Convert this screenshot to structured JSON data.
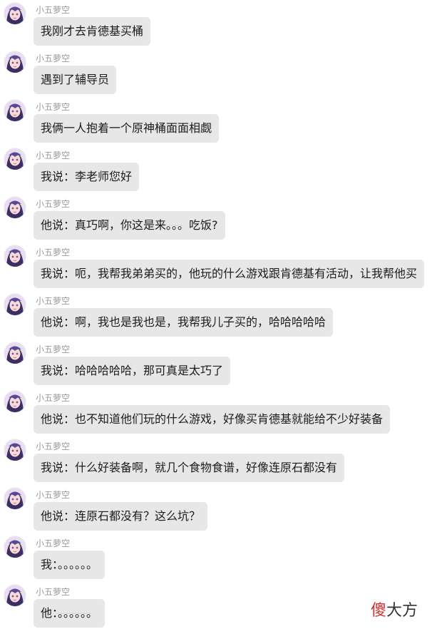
{
  "conversation": {
    "sender_name": "小五萝空",
    "messages": [
      {
        "text": "我刚才去肯德基买桶"
      },
      {
        "text": "遇到了辅导员"
      },
      {
        "text": "我俩一人抱着一个原神桶面面相觑"
      },
      {
        "text": "我说：李老师您好"
      },
      {
        "text": "他说：真巧啊，你这是来。。。吃饭?"
      },
      {
        "text": "我说：呃，我帮我弟弟买的，他玩的什么游戏跟肯德基有活动，让我帮他买"
      },
      {
        "text": "他说：啊，我也是我也是，我帮我儿子买的，哈哈哈哈哈"
      },
      {
        "text": "我说：哈哈哈哈哈，那可真是太巧了"
      },
      {
        "text": "他说：也不知道他们玩的什么游戏，好像买肯德基就能给不少好装备"
      },
      {
        "text": "我说：什么好装备啊，就几个食物食谱，好像连原石都没有"
      },
      {
        "text": "他说：连原石都没有？这么坑？"
      },
      {
        "text": "我：。。。。。。"
      },
      {
        "text": "他：。。。。。。"
      }
    ]
  },
  "watermark": {
    "accent_char": "傻",
    "rest": "大方"
  },
  "colors": {
    "bubble": "#e7e7e7",
    "sender": "#9a9a9a",
    "watermark_accent": "#d22f2f"
  },
  "icons": {
    "avatar": "anime-avatar-icon"
  }
}
